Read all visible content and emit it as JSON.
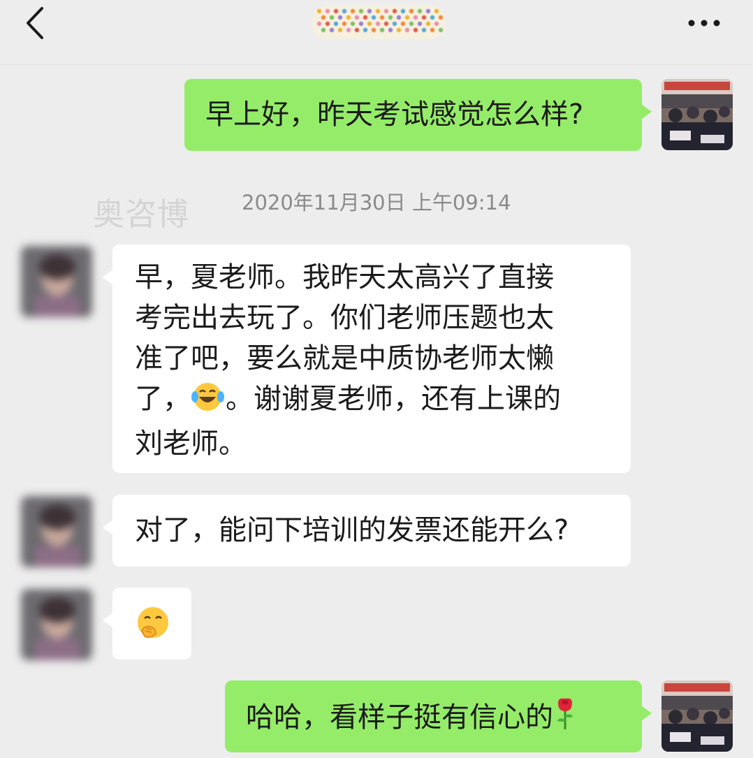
{
  "header": {
    "back_icon": "chevron-left-icon",
    "more_icon": "more-dots-icon",
    "title_obscured": true
  },
  "watermark": "奥咨博",
  "timestamp": "2020年11月30日 上午09:14",
  "messages": [
    {
      "sender": "self",
      "text": "早上好，昨天考试感觉怎么样?"
    },
    {
      "sender": "other",
      "lines": [
        "早，夏老师。我昨天太高兴了直接",
        "考完出去玩了。你们老师压题也太",
        "准了吧，要么就是中质协老师太懒",
        "。谢谢夏老师，还有上课的",
        "刘老师。"
      ],
      "line4_prefix": "了，",
      "inline_emoji": "laughing-crying-emoji"
    },
    {
      "sender": "other",
      "text": "对了，能问下培训的发票还能开么?"
    },
    {
      "sender": "other",
      "emoji": "hand-over-mouth-emoji"
    },
    {
      "sender": "self",
      "text": "哈哈，看样子挺有信心的",
      "trailing_emoji": "rose-emoji"
    }
  ],
  "colors": {
    "background": "#ededed",
    "self_bubble": "#95ec69",
    "other_bubble": "#ffffff",
    "timestamp": "#8a8a8a"
  }
}
